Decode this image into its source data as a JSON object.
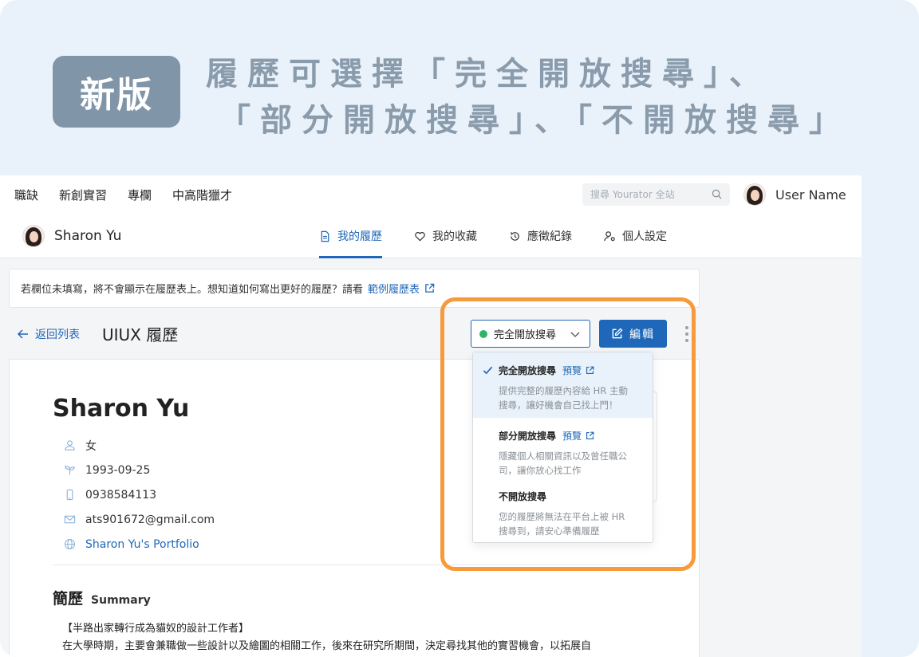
{
  "banner": {
    "badge": "新版",
    "headline_line1": "履歷可選擇「完全開放搜尋」、",
    "headline_line2": "「部分開放搜尋」、「不開放搜尋」"
  },
  "site_nav": {
    "links": [
      "職缺",
      "新創實習",
      "專欄",
      "中高階獵才"
    ],
    "search_placeholder": "搜尋 Yourator 全站",
    "user_name": "User Name"
  },
  "profile_bar": {
    "name": "Sharon Yu",
    "tabs": [
      {
        "label": "我的履歷",
        "icon": "document-icon",
        "active": true
      },
      {
        "label": "我的收藏",
        "icon": "heart-icon",
        "active": false
      },
      {
        "label": "應徵紀錄",
        "icon": "history-icon",
        "active": false
      },
      {
        "label": "個人設定",
        "icon": "user-gear-icon",
        "active": false
      }
    ]
  },
  "notice": {
    "text": "若欄位未填寫，將不會顯示在履歷表上。想知道如何寫出更好的履歷？請看",
    "link": "範例履歷表"
  },
  "resume_header": {
    "back_label": "返回列表",
    "title": "UIUX 履歷",
    "visibility_selected": "完全開放搜尋",
    "edit_label": "編輯"
  },
  "visibility_options": [
    {
      "title": "完全開放搜尋",
      "preview": "預覽",
      "desc_line1": "提供完整的履歷內容給 HR 主動",
      "desc_line2": "搜尋，讓好機會自己找上門！",
      "selected": true
    },
    {
      "title": "部分開放搜尋",
      "preview": "預覽",
      "desc_line1": "隱藏個人相關資訊以及曾任職公",
      "desc_line2": "司，讓你放心找工作",
      "selected": false
    },
    {
      "title": "不開放搜尋",
      "preview": "",
      "desc_line1": "您的履歷將無法在平台上被 HR",
      "desc_line2": "搜尋到，請安心準備履歷",
      "selected": false
    }
  ],
  "resume": {
    "name": "Sharon Yu",
    "gender": "女",
    "birthday": "1993-09-25",
    "phone": "0938584113",
    "email": "ats901672@gmail.com",
    "portfolio": "Sharon Yu's Portfolio",
    "summary_title_zh": "簡歷",
    "summary_title_en": "Summary",
    "summary_line1": "【半路出家轉行成為貓奴的設計工作者】",
    "summary_line2": "在大學時期，主要會兼職做一些設計以及繪圖的相關工作，後來在研究所期間，決定尋找其他的實習機會，以拓展自"
  },
  "colors": {
    "accent": "#1f67b8",
    "highlight": "#f79a3c",
    "status_green": "#2fb36d",
    "badge_bg": "#8195a8",
    "headline": "#8a9bab",
    "frame_bg": "#e9f2fb"
  }
}
